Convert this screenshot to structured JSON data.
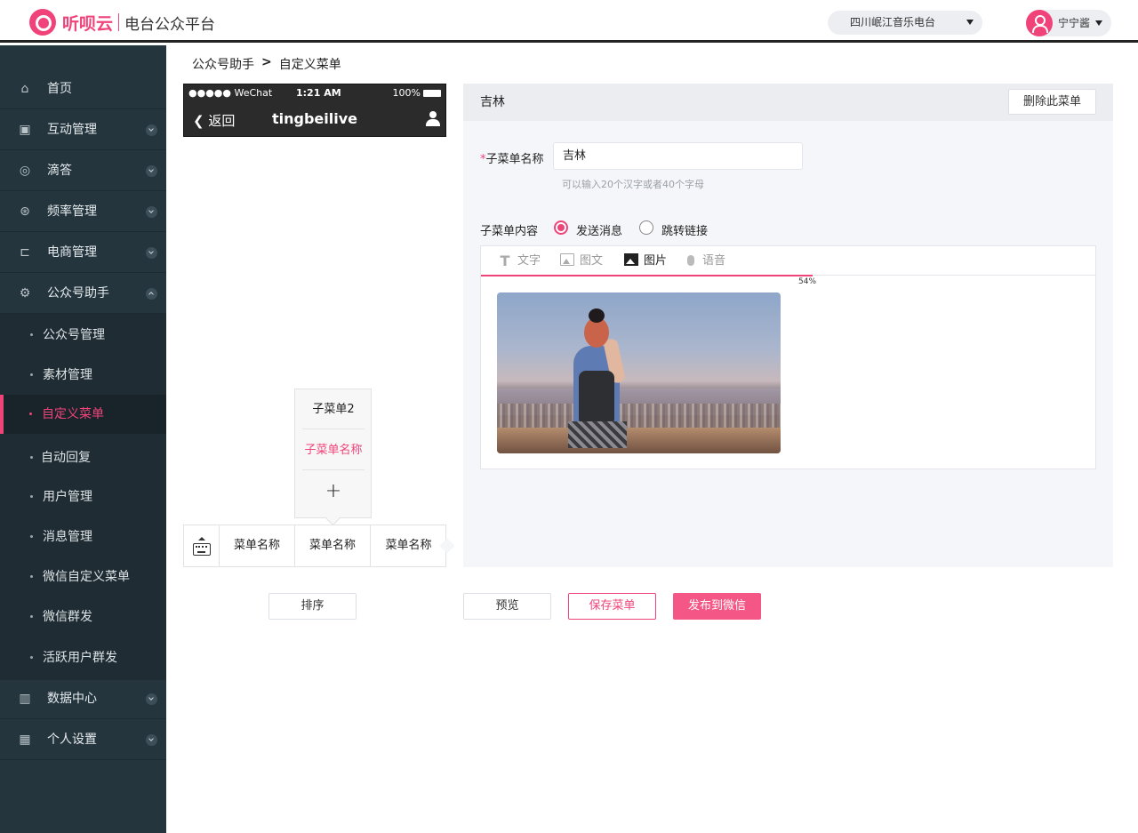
{
  "header": {
    "brand": "听呗云",
    "subtitle": "电台公众平台",
    "station": "四川岷江音乐电台",
    "user_name": "宁宁酱"
  },
  "sidebar": {
    "items": [
      {
        "label": "首页",
        "icon": "home-icon"
      },
      {
        "label": "互动管理",
        "icon": "gift-icon"
      },
      {
        "label": "滴答",
        "icon": "comment-icon"
      },
      {
        "label": "频率管理",
        "icon": "pulse-icon"
      },
      {
        "label": "电商管理",
        "icon": "cart-icon"
      },
      {
        "label": "公众号助手",
        "icon": "gear-icon"
      },
      {
        "label": "数据中心",
        "icon": "bar-chart-icon"
      },
      {
        "label": "个人设置",
        "icon": "grid-icon"
      }
    ],
    "sub_items": [
      {
        "label": "公众号管理"
      },
      {
        "label": "素材管理"
      },
      {
        "label": "自定义菜单"
      },
      {
        "label": "自动回复"
      },
      {
        "label": "用户管理"
      },
      {
        "label": "消息管理"
      },
      {
        "label": "微信自定义菜单"
      },
      {
        "label": "微信群发"
      },
      {
        "label": "活跃用户群发"
      }
    ]
  },
  "breadcrumb": {
    "parent": "公众号助手",
    "separator": ">",
    "current": "自定义菜单"
  },
  "phone": {
    "carrier": "●●●●● WeChat",
    "time": "1:21 AM",
    "battery": "100%",
    "back_label": "返回",
    "title": "tingbeilive",
    "submenu": [
      "子菜单2",
      "子菜单名称",
      "+"
    ],
    "menu_items": [
      "菜单名称",
      "菜单名称",
      "菜单名称"
    ]
  },
  "panel": {
    "title": "吉林",
    "delete_label": "删除此菜单",
    "name_label_req": "*",
    "name_label": "子菜单名称",
    "name_value": "吉林",
    "name_hint": "可以输入20个汉字或者40个字母",
    "content_label": "子菜单内容",
    "radio_send": "发送消息",
    "radio_link": "跳转链接",
    "tabs": [
      "文字",
      "图文",
      "图片",
      "语音"
    ],
    "active_tab": "图片",
    "upload_progress": 54,
    "upload_progress_label": "54%"
  },
  "actions": {
    "sort": "排序",
    "preview": "预览",
    "save": "保存菜单",
    "publish": "发布到微信"
  },
  "colors": {
    "accent": "#f0437a",
    "sidebar_bg": "#24353e"
  }
}
